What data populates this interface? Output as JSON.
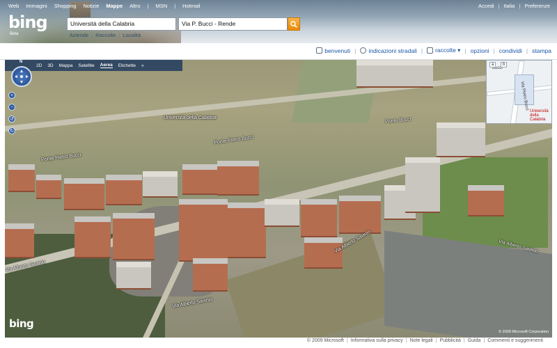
{
  "header": {
    "topnav": [
      "Web",
      "Immagini",
      "Shopping",
      "Notizie",
      "Mappe",
      "Altro",
      "MSN",
      "Hotmail"
    ],
    "active_tab": "Mappe",
    "toplinks": [
      "Accedi",
      "Italia",
      "Preferenze"
    ],
    "logo": "bing",
    "logo_sub": "Beta",
    "search_what": "Università della Calabria",
    "search_where": "Via P. Bucci - Rende",
    "subnav": [
      "Aziende",
      "Raccolte",
      "Località"
    ]
  },
  "toolbar": {
    "items": [
      "benvenuti",
      "indicazioni stradali",
      "raccolte ▾",
      "opzioni",
      "condividi",
      "stampa"
    ]
  },
  "map": {
    "controls": {
      "compass": "N",
      "mode_2d": "2D",
      "mode_3d": "3D",
      "views": [
        "Mappa",
        "Satellite",
        "Aerea"
      ],
      "active_view": "Aerea",
      "labels_toggle": "Etichette",
      "collapse": "«"
    },
    "labels": [
      "Università della Calabria",
      "Ponte Pietro Bucci",
      "Ponte Pietro Bucci",
      "Ponte Bucci",
      "Via Alberto Savinio",
      "Via Alberto Savinio",
      "Via Alberto Savinio",
      "Via Alberto Savinio"
    ],
    "minimap": {
      "labels": [
        "Bucci",
        "Via Pietro Bucci"
      ],
      "place": "Università della Calabria",
      "tabs": [
        "a",
        "b"
      ]
    },
    "logo": "bing",
    "copyright": "© 2009 Microsoft Corporation"
  },
  "footer": {
    "items": [
      "© 2009 Microsoft",
      "Informativa sulla privacy",
      "Note legali",
      "Pubblicità",
      "Guida",
      "Commenti e suggerimenti"
    ]
  },
  "colors": {
    "link": "#1a56a8",
    "search_button": "#e98a06",
    "map_controls": "#16325c"
  }
}
